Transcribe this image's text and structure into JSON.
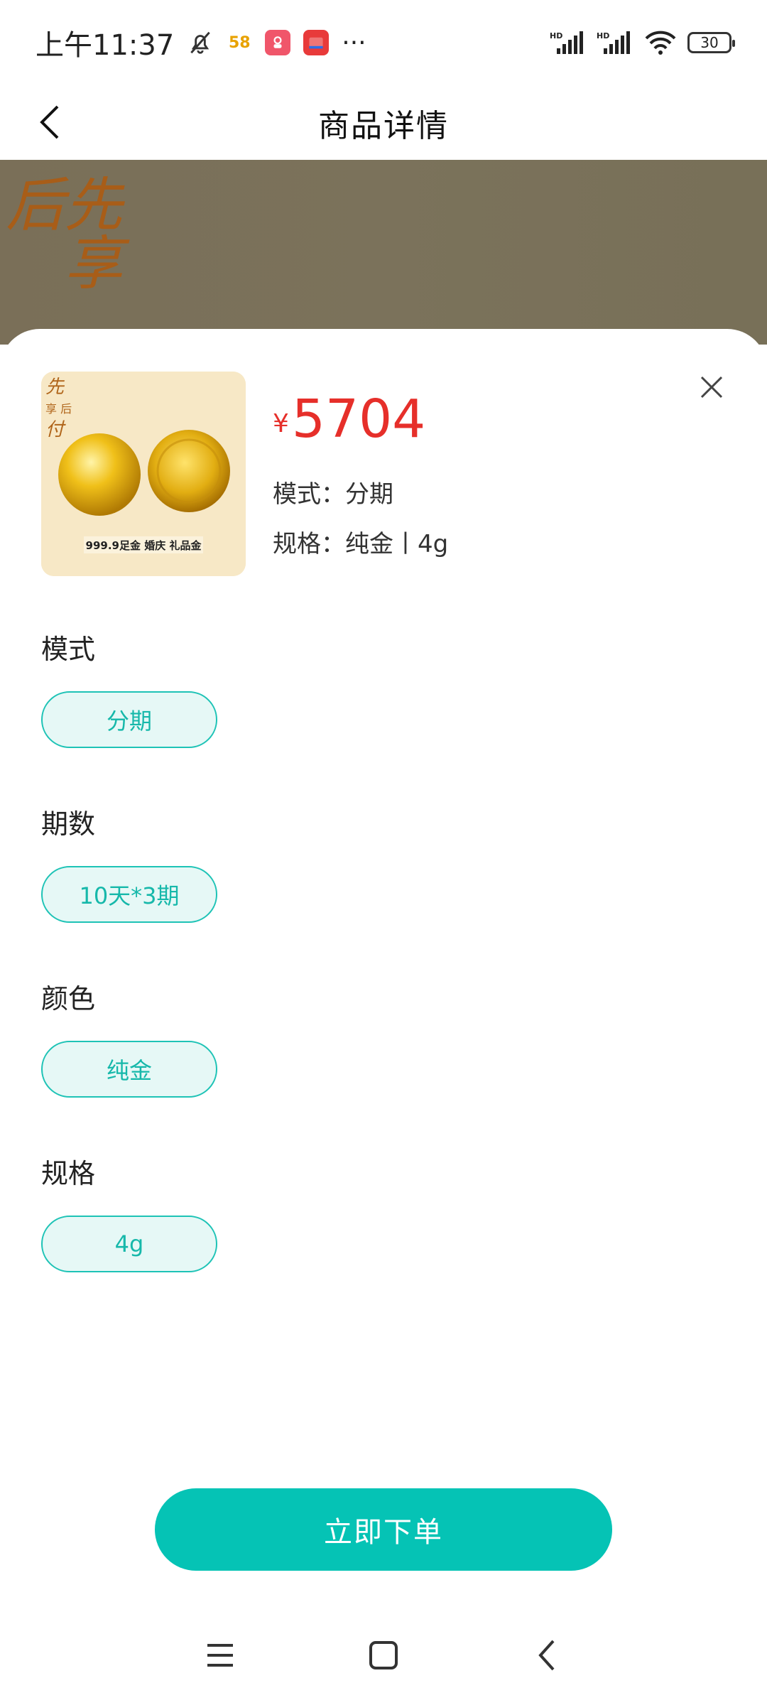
{
  "status_bar": {
    "time": "上午11:37",
    "app_badge_58": "58",
    "more": "···",
    "battery": "30"
  },
  "header": {
    "title": "商品详情"
  },
  "banner": {
    "calligraphy_text": "先享后"
  },
  "product": {
    "image_caption": "999.9足金 婚庆 礼品金",
    "currency_symbol": "¥",
    "price": "5704",
    "mode_line": "模式：分期",
    "spec_line": "规格：纯金丨4g"
  },
  "options": [
    {
      "title": "模式",
      "value": "分期"
    },
    {
      "title": "期数",
      "value": "10天*3期"
    },
    {
      "title": "颜色",
      "value": "纯金"
    },
    {
      "title": "规格",
      "value": "4g"
    }
  ],
  "action": {
    "order_label": "立即下单"
  },
  "colors": {
    "accent": "#05c3b5",
    "price_red": "#e62f2a",
    "chip_bg": "#e6f8f6"
  }
}
